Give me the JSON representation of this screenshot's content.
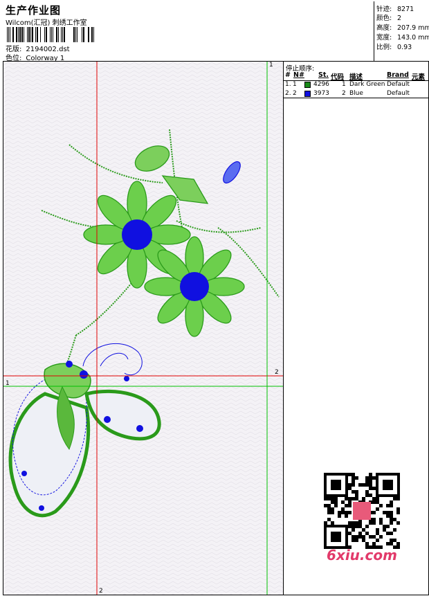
{
  "header": {
    "title": "生产作业图",
    "subtitle": "Wilcom(汇冠) 刺绣工作室",
    "design_label": "花版:",
    "design_value": "2194002.dst",
    "colorway_label": "色位:",
    "colorway_value": "Colorway 1"
  },
  "stats": [
    {
      "label": "针迹:",
      "value": "8271"
    },
    {
      "label": "颜色:",
      "value": "2"
    },
    {
      "label": "高度:",
      "value": "207.9 mm"
    },
    {
      "label": "宽度:",
      "value": "143.0 mm"
    },
    {
      "label": "比例:",
      "value": "0.93"
    }
  ],
  "panel": {
    "title": "停止顺序:",
    "columns": [
      "#",
      "N#",
      "St.",
      "代码",
      "描述",
      "Brand",
      "元素"
    ],
    "rows": [
      {
        "index": "1.",
        "n": "1",
        "color": "#1a8a1a",
        "stitches": "4296",
        "code": "1",
        "desc": "Dark Green",
        "brand": "Default"
      },
      {
        "index": "2.",
        "n": "2",
        "color": "#1010e0",
        "stitches": "3973",
        "code": "2",
        "desc": "Blue",
        "brand": "Default"
      }
    ]
  },
  "guides": {
    "vertical_green_top": "1",
    "red_horizontal_right": "2",
    "green_horizontal_left": "1",
    "red_vertical_bottom": "2"
  },
  "watermark": {
    "text": "6xiu.com"
  },
  "colors": {
    "green": "#2a9a1a",
    "blue": "#1010e0",
    "guide_red": "#e00000",
    "guide_green": "#00c000"
  }
}
